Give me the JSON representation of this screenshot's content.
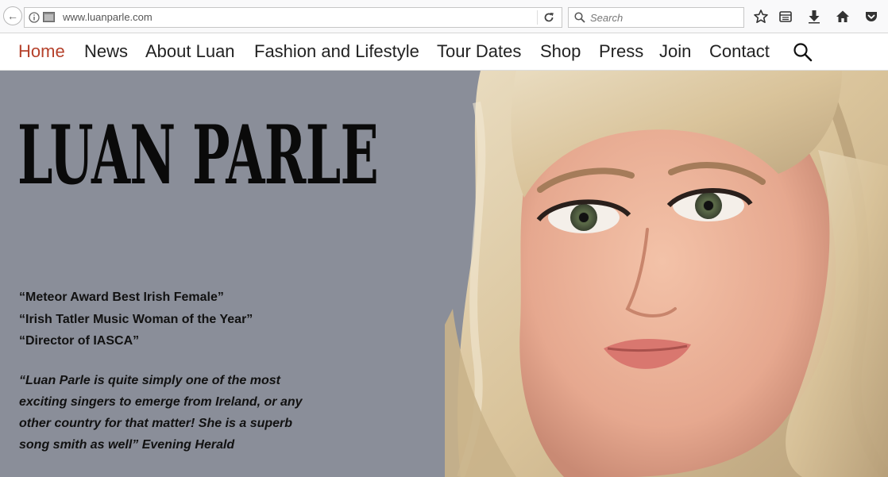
{
  "browser": {
    "url": "www.luanparle.com",
    "search_placeholder": "Search",
    "icons": [
      "back-arrow-icon",
      "info-icon",
      "page-icon",
      "reload-icon",
      "search-icon",
      "star-icon",
      "reading-list-icon",
      "download-icon",
      "home-icon",
      "pocket-icon"
    ]
  },
  "nav": {
    "items": [
      {
        "label": "Home",
        "active": true
      },
      {
        "label": "News"
      },
      {
        "label": "About Luan"
      },
      {
        "label": "Fashion and Lifestyle"
      },
      {
        "label": "Tour Dates"
      },
      {
        "label": "Shop"
      },
      {
        "label": "Press"
      },
      {
        "label": "Join"
      },
      {
        "label": "Contact"
      }
    ],
    "active_color": "#b5412b"
  },
  "hero": {
    "title": "LUAN PARLE",
    "awards": [
      "“Meteor Award Best Irish Female”",
      "“Irish Tatler Music Woman of the Year”",
      "“Director of IASCA”"
    ],
    "quote": "“Luan Parle is quite simply one of the most exciting singers to emerge from Ireland, or any other country for that matter! She is a superb song smith as well” Evening Herald",
    "background_color": "#8a8e99"
  }
}
